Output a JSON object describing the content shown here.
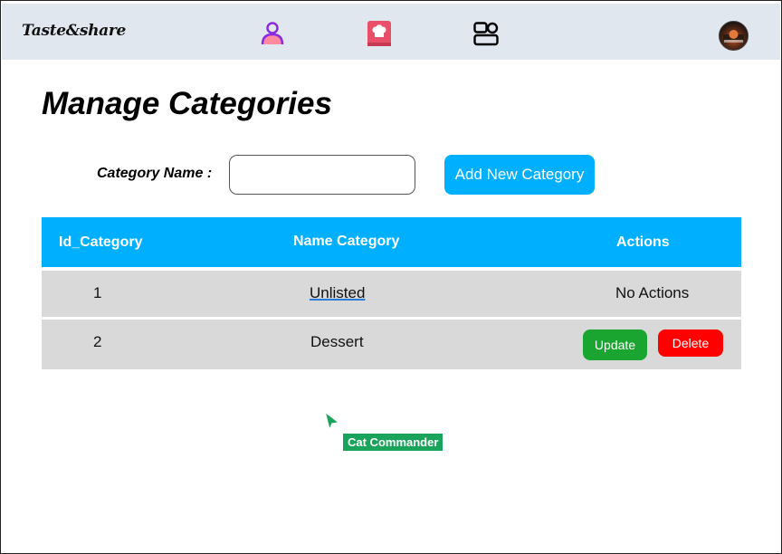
{
  "header": {
    "brand": "Taste&share",
    "nav_icons": [
      "user-icon",
      "chef-book-icon",
      "dashboard-icon"
    ],
    "avatar": "avatar"
  },
  "page": {
    "title": "Manage Categories"
  },
  "form": {
    "label": "Category Name :",
    "input_value": "",
    "add_button_label": "Add New Category"
  },
  "table": {
    "headers": [
      "Id_Category",
      "Name Category",
      "Actions"
    ],
    "rows": [
      {
        "id": "1",
        "name": "Unlisted",
        "actions": "No Actions"
      },
      {
        "id": "2",
        "name": "Dessert",
        "update_label": "Update",
        "delete_label": "Delete"
      }
    ]
  },
  "collaborator": {
    "name": "Cat Commander",
    "color": "#1aa35a"
  },
  "colors": {
    "accent": "#00b0ff",
    "header_bg": "#e1e7ee",
    "row_bg": "#d9d9d9",
    "update": "#1aa531",
    "delete": "#ff0000",
    "user_icon_purple": "#8a2be2",
    "user_icon_pink": "#ff8aa0"
  }
}
